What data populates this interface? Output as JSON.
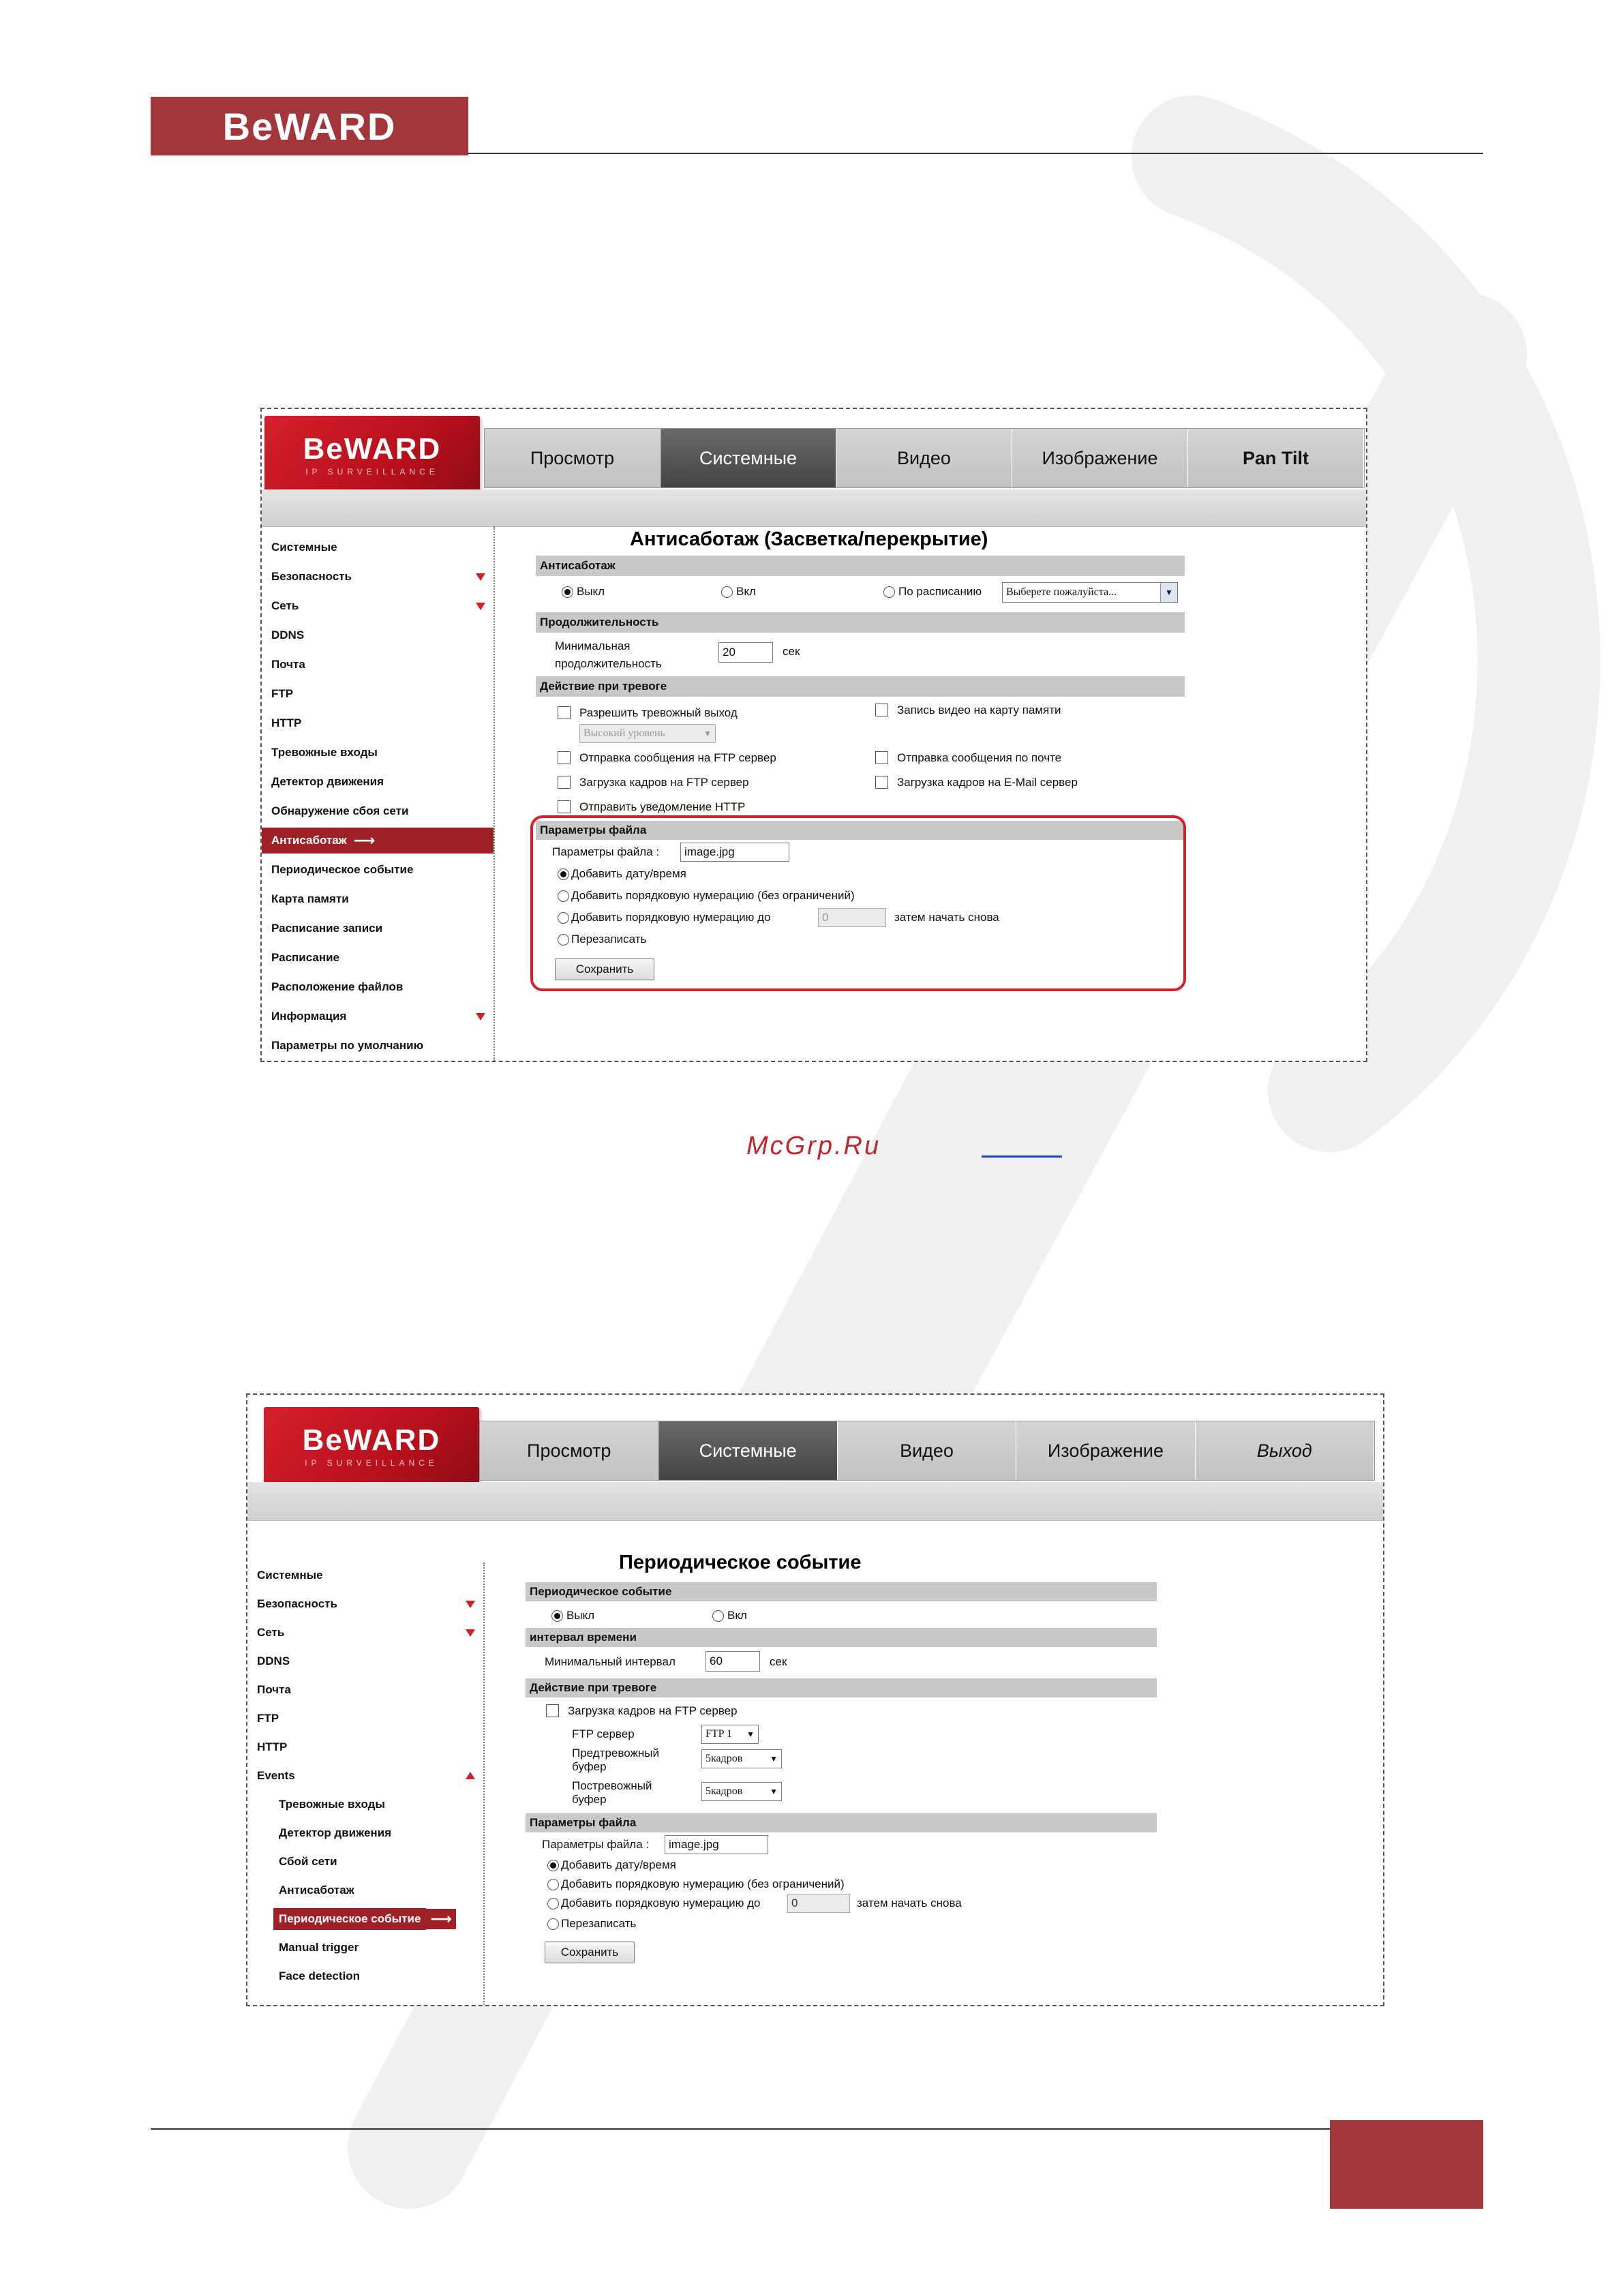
{
  "page": {
    "brand": "BeWARD",
    "accent_color": "#a3363a",
    "caption": "McGrp.Ru"
  },
  "shot1": {
    "logo": {
      "brand": "BeWARD",
      "tagline": "IP SURVEILLANCE"
    },
    "nav": [
      "Просмотр",
      "Системные",
      "Видео",
      "Изображение",
      "Pan Tilt"
    ],
    "sidebar": [
      "Системные",
      "Безопасность",
      "Сеть",
      "DDNS",
      "Почта",
      "FTP",
      "HTTP",
      "Тревожные входы",
      "Детектор движения",
      "Обнаружение сбоя сети",
      "Антисаботаж",
      "Периодическое событие",
      "Карта памяти",
      "Расписание записи",
      "Расписание",
      "Расположение файлов",
      "Информация",
      "Параметры по умолчанию"
    ],
    "title": "Антисаботаж (Засветка/перекрытие)",
    "sec_antisabotage": "Антисаботаж",
    "radio_off": "Выкл",
    "radio_on": "Вкл",
    "radio_schedule": "По расписанию",
    "schedule_select": "Выберете пожалуйста...",
    "sec_duration": "Продолжительность",
    "min_duration_1": "Минимальная",
    "min_duration_2": "продолжительность",
    "min_duration_value": "20",
    "sec_unit": "сек",
    "sec_action": "Действие при тревоге",
    "alarm_out": "Разрешить тревожный выход",
    "alarm_level": "Высокий уровень",
    "record_card": "Запись видео на карту памяти",
    "ftp_msg": "Отправка сообщения на FTP сервер",
    "mail_msg": "Отправка сообщения по почте",
    "ftp_frames": "Загрузка кадров на FTP сервер",
    "mail_frames": "Загрузка кадров на E-Mail сервер",
    "http_notify": "Отправить уведомление HTTP",
    "sec_file": "Параметры файла",
    "file_label": "Параметры файла :",
    "file_value": "image.jpg",
    "opt_datetime": "Добавить дату/время",
    "opt_seq_unlimited": "Добавить порядковую нумерацию (без ограничений)",
    "opt_seq_upto": "Добавить порядковую нумерацию до",
    "seq_value": "0",
    "opt_restart": "затем начать снова",
    "opt_overwrite": "Перезаписать",
    "save": "Сохранить"
  },
  "shot2": {
    "logo": {
      "brand": "BeWARD",
      "tagline": "IP SURVEILLANCE"
    },
    "nav": [
      "Просмотр",
      "Системные",
      "Видео",
      "Изображение",
      "Выход"
    ],
    "sidebar": [
      "Системные",
      "Безопасность",
      "Сеть",
      "DDNS",
      "Почта",
      "FTP",
      "HTTP",
      "Events",
      "Тревожные входы",
      "Детектор движения",
      "Сбой сети",
      "Антисаботаж",
      "Периодическое событие",
      "Manual trigger",
      "Face detection"
    ],
    "title": "Периодическое событие",
    "sec_periodic": "Периодическое событие",
    "radio_off": "Выкл",
    "radio_on": "Вкл",
    "sec_interval": "интервал времени",
    "min_interval": "Минимальный интервал",
    "min_interval_value": "60",
    "sec_unit": "сек",
    "sec_action": "Действие при тревоге",
    "ftp_frames": "Загрузка кадров на FTP сервер",
    "ftp_server": "FTP сервер",
    "ftp_server_value": "FTP 1",
    "prebuf_1": "Предтревожный",
    "prebuf_2": "буфер",
    "prebuf_value": "5кадров",
    "postbuf_1": "Постревожный",
    "postbuf_2": "буфер",
    "postbuf_value": "5кадров",
    "sec_file": "Параметры файла",
    "file_label": "Параметры файла :",
    "file_value": "image.jpg",
    "opt_datetime": "Добавить дату/время",
    "opt_seq_unlimited": "Добавить порядковую нумерацию (без ограничений)",
    "opt_seq_upto": "Добавить порядковую нумерацию до",
    "seq_value": "0",
    "opt_restart": "затем начать снова",
    "opt_overwrite": "Перезаписать",
    "save": "Сохранить"
  }
}
